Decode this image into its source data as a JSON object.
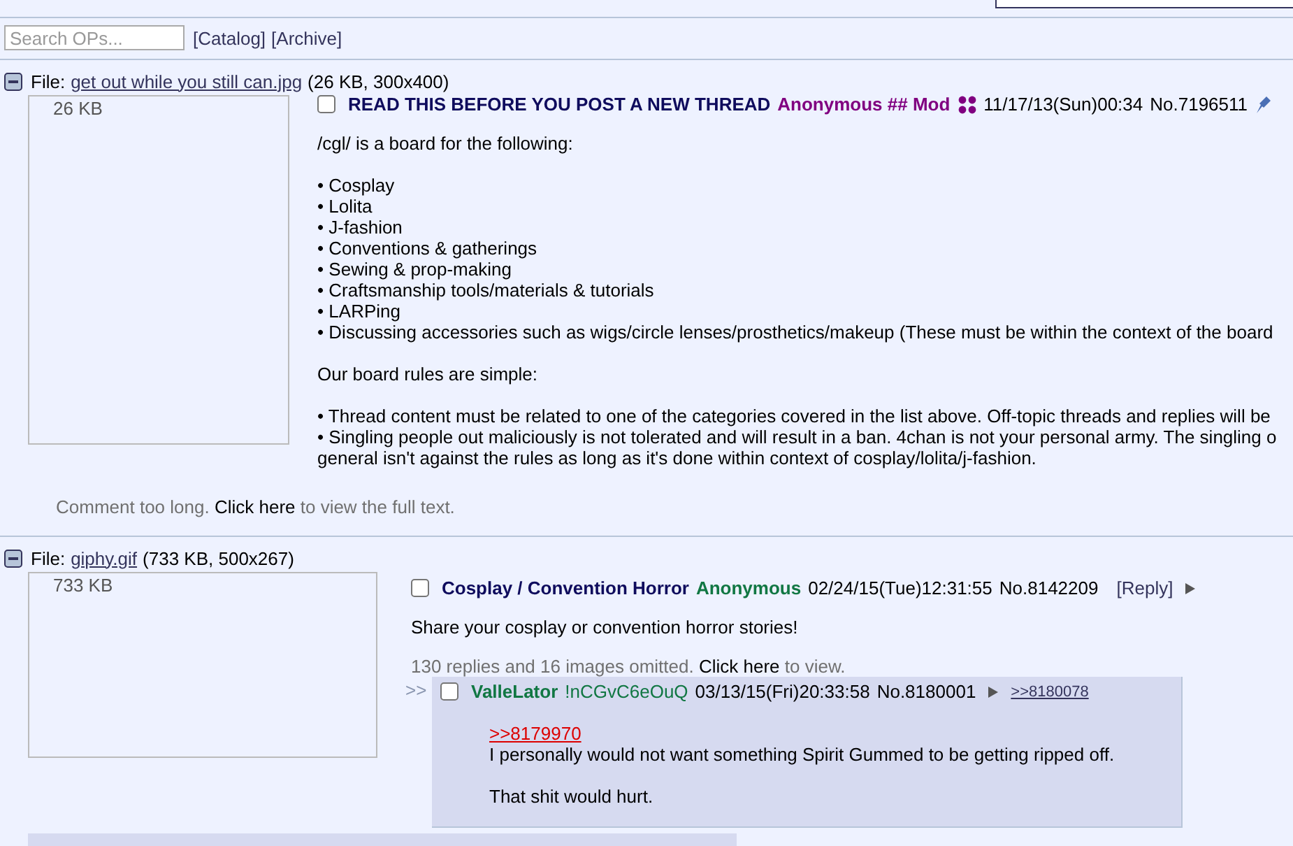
{
  "search": {
    "placeholder": "Search OPs..."
  },
  "nav_links": [
    "[Catalog]",
    "[Archive]"
  ],
  "threads": [
    {
      "file_label": "File:",
      "file_name": "get out while you still can.jpg",
      "file_info": "(26 KB, 300x400)",
      "thumb_alt": "26 KB",
      "op": {
        "checked": false,
        "subject": "READ THIS BEFORE YOU POST A NEW THREAD",
        "name": "Anonymous ## Mod",
        "kind": "mod",
        "date": "11/17/13(Sun)00:34",
        "number": "No.7196511",
        "pinned": true,
        "paragraphs": [
          [
            "/cgl/ is a board for the following:"
          ],
          [
            "• Cosplay",
            "• Lolita",
            "• J-fashion",
            "• Conventions & gatherings",
            "• Sewing & prop-making",
            "• Craftsmanship tools/materials & tutorials",
            "• LARPing",
            "• Discussing accessories such as wigs/circle lenses/prosthetics/makeup (These must be within the context of the board"
          ],
          [
            "Our board rules are simple:"
          ],
          [
            "• Thread content must be related to one of the categories covered in the list above. Off-topic threads and replies will be",
            "• Singling people out maliciously is not tolerated and will result in a ban. 4chan is not your personal army. The singling o",
            "general isn't against the rules as long as it's done within context of cosplay/lolita/j-fashion."
          ]
        ]
      },
      "note": {
        "before": "Comment too long.",
        "link": "Click here",
        "after": "to view the full text."
      }
    },
    {
      "file_label": "File:",
      "file_name": "giphy.gif",
      "file_info": "(733 KB, 500x267)",
      "thumb_alt": "733 KB",
      "op": {
        "checked": false,
        "subject": "Cosplay / Convention Horror",
        "name": "Anonymous",
        "kind": "user",
        "date": "02/24/15(Tue)12:31:55",
        "number": "No.8142209",
        "reply_link": "[Reply]",
        "paragraphs": [
          [
            "Share your cosplay or convention horror stories!"
          ]
        ]
      },
      "note": {
        "before": "130 replies and 16 images omitted.",
        "link": "Click here",
        "after": "to view."
      },
      "replies": [
        {
          "marker": ">>",
          "checked": false,
          "name": "ValleLator",
          "tripcode": "!nCGvC6eOuQ",
          "date": "03/13/15(Fri)20:33:58",
          "number": "No.8180001",
          "backlink": ">>8180078",
          "quote": ">>8179970",
          "paragraphs": [
            [
              "I personally would not want something Spirit Gummed to be getting ripped off."
            ],
            [
              "That shit would hurt."
            ]
          ]
        }
      ]
    }
  ]
}
